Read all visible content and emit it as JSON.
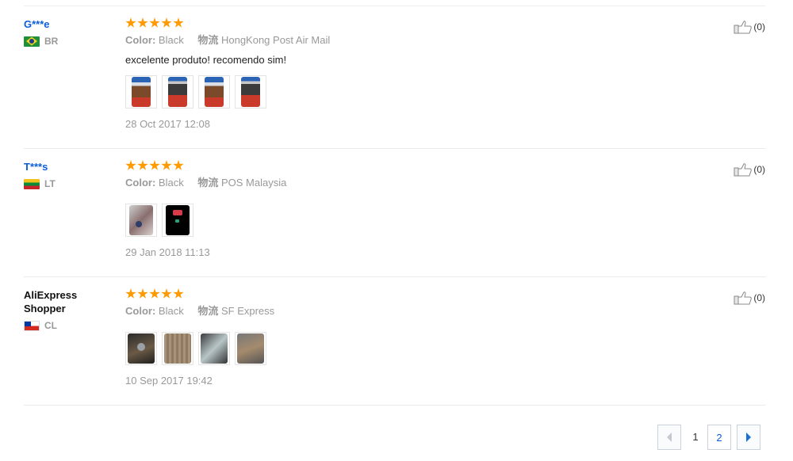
{
  "reviews": [
    {
      "user": "G***e",
      "country": "BR",
      "rating": 5,
      "color_label": "Color:",
      "color_value": "Black",
      "ship_label": "物流",
      "ship_value": "HongKong Post Air Mail",
      "text": "excelente produto! recomendo sim!",
      "date": "28 Oct 2017 12:08",
      "useful_count": "(0)"
    },
    {
      "user": "T***s",
      "country": "LT",
      "rating": 5,
      "color_label": "Color:",
      "color_value": "Black",
      "ship_label": "物流",
      "ship_value": "POS Malaysia",
      "text": "",
      "date": "29 Jan 2018 11:13",
      "useful_count": "(0)"
    },
    {
      "user": "AliExpress Shopper",
      "country": "CL",
      "rating": 5,
      "color_label": "Color:",
      "color_value": "Black",
      "ship_label": "物流",
      "ship_value": "SF Express",
      "text": "",
      "date": "10 Sep 2017 19:42",
      "useful_count": "(0)"
    }
  ],
  "pagination": {
    "prev_icon": "chevron-left-icon",
    "pages": [
      "1",
      "2"
    ],
    "current_page": "2",
    "next_icon": "chevron-right-icon"
  },
  "colors": {
    "star": "#ff9a00",
    "link": "#0b5ed7",
    "muted": "#999999"
  }
}
